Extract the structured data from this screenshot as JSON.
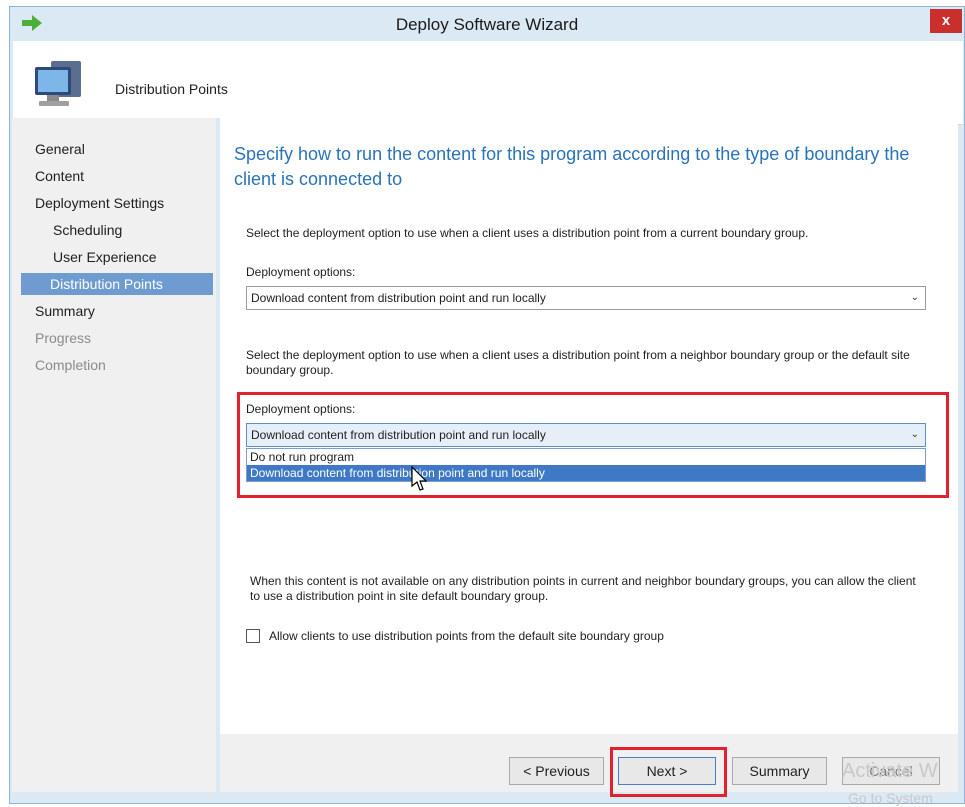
{
  "window": {
    "title": "Deploy Software Wizard",
    "close_label": "x"
  },
  "header": {
    "title": "Distribution Points"
  },
  "sidebar": {
    "items": [
      {
        "label": "General",
        "state": "normal"
      },
      {
        "label": "Content",
        "state": "normal"
      },
      {
        "label": "Deployment Settings",
        "state": "normal"
      },
      {
        "label": "Scheduling",
        "state": "normal"
      },
      {
        "label": "User Experience",
        "state": "normal"
      },
      {
        "label": "Distribution Points",
        "state": "active"
      },
      {
        "label": "Summary",
        "state": "normal"
      },
      {
        "label": "Progress",
        "state": "disabled"
      },
      {
        "label": "Completion",
        "state": "disabled"
      }
    ]
  },
  "main": {
    "heading": "Specify how to run the content for this program according to the type of boundary the client is connected to",
    "section1": {
      "description": "Select the deployment option to use when a client uses a distribution point from a current boundary group.",
      "label": "Deployment options:",
      "selected": "Download content from distribution point and run locally"
    },
    "section2": {
      "description": "Select the deployment option to use when a client uses a distribution point from a neighbor boundary group or the default site boundary group.",
      "label": "Deployment options:",
      "selected": "Download content from distribution point and run locally",
      "options": [
        "Do not run program",
        "Download content from distribution point and run locally"
      ]
    },
    "section3": {
      "description": "When this content is not available on any distribution points in current and neighbor boundary groups, you can allow the client to use a distribution point in site default boundary group.",
      "checkbox_label": "Allow clients to use distribution points from the default site boundary group",
      "checked": false
    }
  },
  "footer": {
    "previous_label": "< Previous",
    "next_label": "Next >",
    "summary_label": "Summary",
    "cancel_label": "Cancel"
  },
  "watermark": {
    "line1": "Activate W",
    "line2": "Go to System"
  },
  "colors": {
    "accent": "#2a73b8",
    "highlight": "#e2202e",
    "selection": "#3f79c6"
  }
}
